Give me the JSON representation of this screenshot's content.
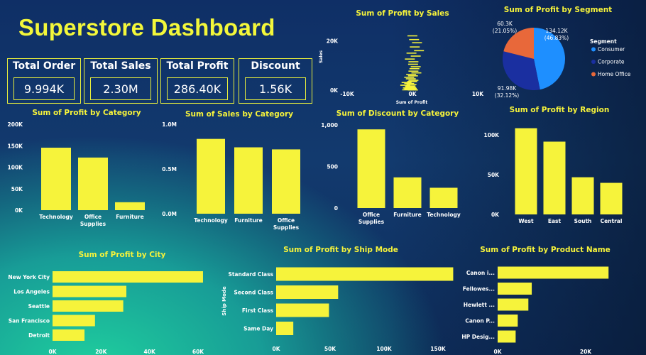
{
  "dashboard": {
    "title": "Superstore Dashboard"
  },
  "kpis": [
    {
      "label": "Total Order",
      "value": "9.994K"
    },
    {
      "label": "Total Sales",
      "value": "2.30M"
    },
    {
      "label": "Total Profit",
      "value": "286.40K"
    },
    {
      "label": "Discount",
      "value": "1.56K"
    }
  ],
  "colors": {
    "bar": "#f6f33b",
    "consumer": "#1e8fff",
    "corporate": "#1a2fa0",
    "home_office": "#e8683a"
  },
  "chart_data": [
    {
      "id": "profit_by_category",
      "type": "bar",
      "title": "Sum of Profit by Category",
      "categories": [
        "Technology",
        "Office Supplies",
        "Furniture"
      ],
      "values": [
        145455,
        122491,
        18451
      ],
      "ylim": [
        0,
        200000
      ],
      "yticks": [
        "0K",
        "50K",
        "100K",
        "150K",
        "200K"
      ]
    },
    {
      "id": "sales_by_category",
      "type": "bar",
      "title": "Sum of Sales by Category",
      "categories": [
        "Technology",
        "Furniture",
        "Office Supplies"
      ],
      "values": [
        836154,
        741999,
        719047
      ],
      "ylim": [
        0,
        1000000
      ],
      "yticks": [
        "0.0M",
        "0.5M",
        "1.0M"
      ]
    },
    {
      "id": "discount_by_category",
      "type": "bar",
      "title": "Sum of Discount by Category",
      "categories": [
        "Office Supplies",
        "Furniture",
        "Technology"
      ],
      "values": [
        947,
        369,
        244
      ],
      "ylim": [
        0,
        1000
      ],
      "yticks": [
        "0",
        "500",
        "1,000"
      ]
    },
    {
      "id": "profit_by_region",
      "type": "bar",
      "title": "Sum of Profit by Region",
      "categories": [
        "West",
        "East",
        "South",
        "Central"
      ],
      "values": [
        108418,
        91523,
        46749,
        39706
      ],
      "ylim": [
        0,
        100000
      ],
      "yticks": [
        "0K",
        "50K",
        "100K"
      ]
    },
    {
      "id": "profit_by_city",
      "type": "hbar",
      "title": "Sum of Profit by City",
      "categories": [
        "New York City",
        "Los Angeles",
        "Seattle",
        "San Francisco",
        "Detroit"
      ],
      "values": [
        62037,
        30441,
        29156,
        17507,
        13181
      ],
      "xlim": [
        0,
        60000
      ],
      "xticks": [
        "0K",
        "20K",
        "40K",
        "60K"
      ]
    },
    {
      "id": "profit_by_shipmode",
      "type": "hbar",
      "title": "Sum of Profit by Ship Mode",
      "categories": [
        "Standard Class",
        "Second Class",
        "First Class",
        "Same Day"
      ],
      "values": [
        164089,
        57447,
        48970,
        15892
      ],
      "xlim": [
        0,
        150000
      ],
      "xticks": [
        "0K",
        "50K",
        "100K",
        "150K"
      ],
      "ylabel": "Ship Mode"
    },
    {
      "id": "profit_by_product",
      "type": "hbar",
      "title": "Sum of Profit by Product Name",
      "categories": [
        "Canon i...",
        "Fellowes...",
        "Hewlett ...",
        "Canon P...",
        "HP Desig..."
      ],
      "values": [
        25200,
        7753,
        6984,
        4571,
        4095
      ],
      "xlim": [
        0,
        20000
      ],
      "xticks": [
        "0K",
        "20K"
      ]
    },
    {
      "id": "profit_by_segment",
      "type": "pie",
      "title": "Sum of Profit by Segment",
      "legend_title": "Segment",
      "series": [
        {
          "name": "Consumer",
          "value": 134.12,
          "label": "134.12K",
          "pct": "(46.83%)"
        },
        {
          "name": "Corporate",
          "value": 91.98,
          "label": "91.98K",
          "pct": "(32.12%)"
        },
        {
          "name": "Home Office",
          "value": 60.3,
          "label": "60.3K",
          "pct": "(21.05%)"
        }
      ]
    },
    {
      "id": "profit_by_sales",
      "type": "scatter",
      "title": "Sum of Profit by Sales",
      "xlabel": "Sum of Profit",
      "ylabel": "Sales",
      "xticks": [
        "-10K",
        "0K",
        "10K"
      ],
      "yticks": [
        "0K",
        "20K"
      ],
      "xlim": [
        -10000,
        10000
      ],
      "ylim": [
        0,
        23000
      ],
      "points": [
        [
          0,
          22000
        ],
        [
          250,
          20500
        ],
        [
          700,
          19200
        ],
        [
          350,
          17500
        ],
        [
          1000,
          16000
        ],
        [
          -150,
          15000
        ],
        [
          500,
          13800
        ],
        [
          -400,
          12600
        ],
        [
          150,
          11500
        ],
        [
          100,
          10500
        ],
        [
          500,
          9500
        ],
        [
          300,
          8700
        ],
        [
          150,
          7700
        ],
        [
          600,
          7000
        ],
        [
          -200,
          6400
        ],
        [
          80,
          5800
        ],
        [
          -500,
          5200
        ],
        [
          -250,
          4600
        ],
        [
          150,
          4000
        ],
        [
          -30,
          3500
        ],
        [
          -900,
          3100
        ],
        [
          -500,
          2700
        ],
        [
          -150,
          2300
        ],
        [
          -1100,
          2000
        ],
        [
          -300,
          1700
        ],
        [
          -400,
          1400
        ],
        [
          -200,
          1100
        ],
        [
          -700,
          900
        ],
        [
          -100,
          700
        ],
        [
          -500,
          500
        ],
        [
          -250,
          350
        ],
        [
          -50,
          200
        ],
        [
          -800,
          150
        ],
        [
          80,
          100
        ]
      ]
    }
  ]
}
